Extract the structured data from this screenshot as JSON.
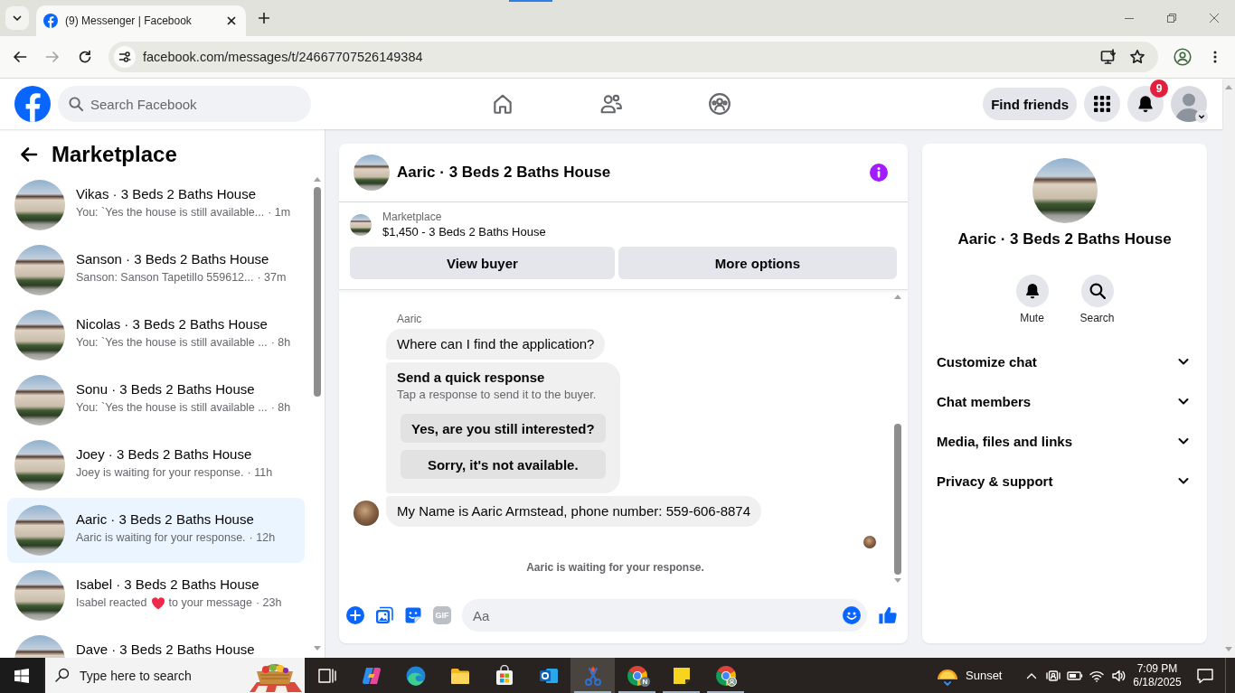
{
  "browser": {
    "tab_title": "(9) Messenger | Facebook",
    "url": "facebook.com/messages/t/24667707526149384"
  },
  "header": {
    "search_placeholder": "Search Facebook",
    "find_friends": "Find friends",
    "notification_count": "9"
  },
  "sidebar": {
    "title": "Marketplace",
    "conversations": [
      {
        "kind": "message",
        "name": "Vikas · 3 Beds 2 Baths House",
        "preview": "You: `Yes the house is still available...",
        "time": "· 1m",
        "selected": false
      },
      {
        "kind": "message",
        "name": "Sanson · 3 Beds 2 Baths House",
        "preview": "Sanson: Sanson Tapetillo 559612...",
        "time": "· 37m",
        "selected": false
      },
      {
        "kind": "message",
        "name": "Nicolas · 3 Beds 2 Baths House",
        "preview": "You: `Yes the house is still available ...",
        "time": "· 8h",
        "selected": false
      },
      {
        "kind": "message",
        "name": "Sonu · 3 Beds 2 Baths House",
        "preview": "You: `Yes the house is still available ...",
        "time": "· 8h",
        "selected": false
      },
      {
        "kind": "message",
        "name": "Joey · 3 Beds 2 Baths House",
        "preview": "Joey is waiting for your response.",
        "time": "· 11h",
        "selected": false
      },
      {
        "kind": "message",
        "name": "Aaric · 3 Beds 2 Baths House",
        "preview": "Aaric is waiting for your response.",
        "time": "· 12h",
        "selected": true
      },
      {
        "kind": "reaction",
        "name": "Isabel · 3 Beds 2 Baths House",
        "preview": "Isabel reacted",
        "preview_end": "to your message",
        "time": "· 23h",
        "selected": false
      },
      {
        "kind": "message",
        "name": "Dave · 3 Beds 2 Baths House",
        "selected": false
      }
    ]
  },
  "chat": {
    "title": "Aaric · 3 Beds 2 Baths House",
    "listing": {
      "source": "Marketplace",
      "summary": "$1,450 - 3 Beds 2 Baths House"
    },
    "actions": [
      "View buyer",
      "More options"
    ],
    "messages": [
      {
        "kind": "text",
        "sender": "Aaric",
        "text": "Where can I find the application?",
        "avatar": false,
        "seen": false
      },
      {
        "kind": "quick_response",
        "title": "Send a quick response",
        "hint": "Tap a response to send it to the buyer.",
        "options": [
          "Yes, are you still interested?",
          "Sorry, it's not available."
        ]
      },
      {
        "kind": "text",
        "text": "My Name is Aaric Armstead, phone number: 559-606-8874",
        "avatar": true,
        "seen": true
      }
    ],
    "status": "Aaric is waiting for your response.",
    "composer": {
      "gif": "GIF",
      "placeholder": "Aa"
    }
  },
  "details": {
    "title": "Aaric · 3 Beds 2 Baths House",
    "actions": [
      {
        "kind": "mute",
        "label": "Mute"
      },
      {
        "kind": "search",
        "label": "Search"
      }
    ],
    "sections": [
      {
        "label": "Customize chat",
        "expanded": false
      },
      {
        "label": "Chat members",
        "expanded": false
      },
      {
        "label": "Media, files and links",
        "expanded": false
      },
      {
        "label": "Privacy & support",
        "expanded": false
      }
    ]
  },
  "taskbar": {
    "search_placeholder": "Type here to search",
    "apps": [
      {
        "selected": false,
        "running": false
      },
      {
        "selected": false,
        "running": false
      },
      {
        "selected": false,
        "running": false
      },
      {
        "selected": false,
        "running": false
      },
      {
        "selected": false,
        "running": false
      },
      {
        "selected": false,
        "running": false
      },
      {
        "selected": true,
        "running": true
      },
      {
        "selected": false,
        "running": true,
        "badge": "N"
      },
      {
        "selected": false,
        "running": true
      },
      {
        "selected": false,
        "running": true
      }
    ],
    "weather": "Sunset",
    "time": "7:09 PM",
    "date": "6/18/2025"
  }
}
